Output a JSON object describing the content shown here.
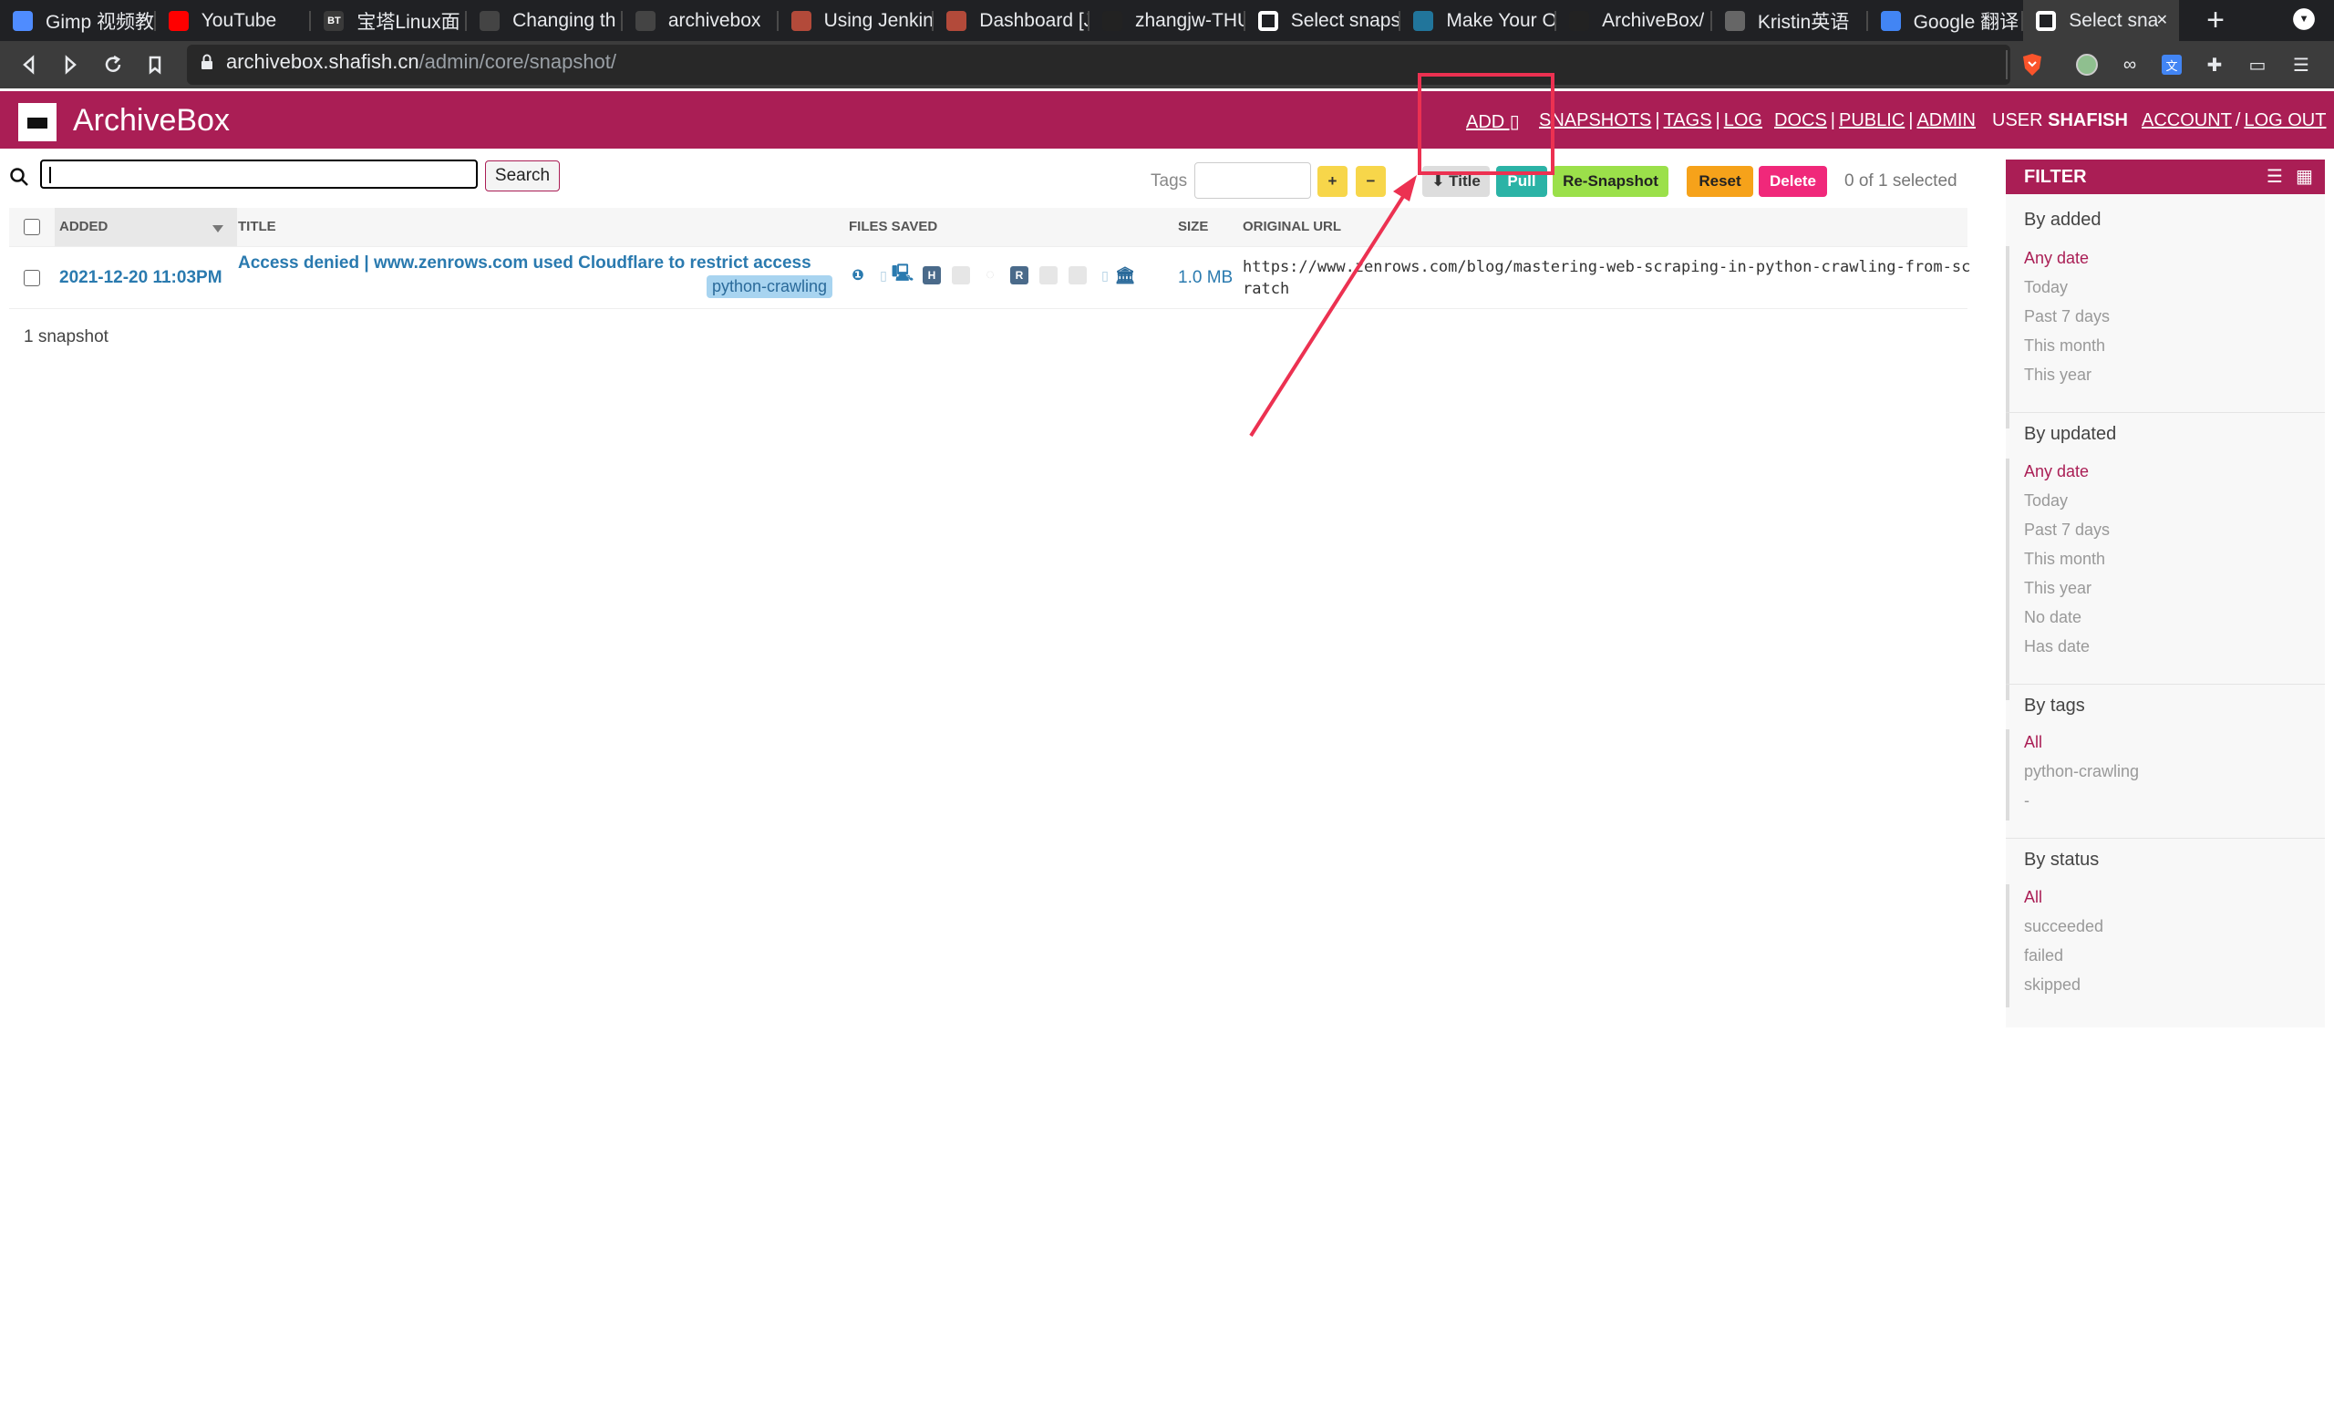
{
  "browser": {
    "tabs": [
      {
        "label": "Gimp 视频教",
        "icon": "calendar-icon",
        "color": "#4f8cff"
      },
      {
        "label": "YouTube",
        "icon": "youtube-icon",
        "color": "#ff0000"
      },
      {
        "label": "宝塔Linux面",
        "icon": "bt-icon",
        "color": "#3a3a3a",
        "glyph": "BT"
      },
      {
        "label": "Changing th",
        "icon": "owl-icon",
        "color": "#444444"
      },
      {
        "label": "archivebox",
        "icon": "bird-icon",
        "color": "#444444"
      },
      {
        "label": "Using Jenkins",
        "icon": "jenkins-icon",
        "color": "#b34a3a"
      },
      {
        "label": "Dashboard [J",
        "icon": "jenkins-icon",
        "color": "#b34a3a"
      },
      {
        "label": "zhangjw-THU",
        "icon": "github-icon",
        "color": "#222222"
      },
      {
        "label": "Select snaps",
        "icon": "archivebox-icon",
        "color": "#ffffff"
      },
      {
        "label": "Make Your O",
        "icon": "wordpress-icon",
        "color": "#21759b"
      },
      {
        "label": "ArchiveBox/",
        "icon": "github-icon",
        "color": "#222222"
      },
      {
        "label": "Kristin英语",
        "icon": "globe-icon",
        "color": "#666666"
      },
      {
        "label": "Google 翻译",
        "icon": "google-translate-icon",
        "color": "#4285f4"
      },
      {
        "label": "Select sna",
        "icon": "archivebox-icon",
        "color": "#ffffff",
        "active": true
      }
    ],
    "url_host": "archivebox.shafish.cn",
    "url_path": "/admin/core/snapshot/"
  },
  "header": {
    "brand": "ArchiveBox",
    "add": "ADD ▯",
    "snapshots": "SNAPSHOTS",
    "tags": "TAGS",
    "log": "LOG",
    "docs": "DOCS",
    "public": "PUBLIC",
    "admin": "ADMIN",
    "user_prefix": "USER",
    "username": "SHAFISH",
    "account": "ACCOUNT",
    "logout": "LOG OUT",
    "pipe": "|",
    "slash": "/"
  },
  "toolbar": {
    "search_button": "Search",
    "tags_label": "Tags",
    "add_tag": "+",
    "remove_tag": "−",
    "title_button": "⬇ Title",
    "pull_button": "Pull",
    "resnapshot_button": "Re-Snapshot",
    "reset_button": "Reset",
    "delete_button": "Delete",
    "selected_count": "0 of 1 selected",
    "colors": {
      "yellow": "#f7d64a",
      "gray": "#dddddd",
      "teal": "#2bb3a6",
      "green": "#9be04a",
      "orange": "#f6a21a",
      "pink": "#f0287a"
    }
  },
  "table": {
    "columns": {
      "added": "ADDED",
      "title": "TITLE",
      "files_saved": "FILES SAVED",
      "size": "SIZE",
      "original_url": "ORIGINAL URL"
    },
    "rows": [
      {
        "added": "2021-12-20 11:03PM",
        "title": "Access denied | www.zenrows.com used Cloudflare to restrict access",
        "tag": "python-crawling",
        "size": "1.0 MB",
        "url": "https://www.zenrows.com/blog/mastering-web-scraping-in-python-crawling-from-scratch"
      }
    ],
    "count": "1 snapshot"
  },
  "filter": {
    "title": "FILTER",
    "by_added": {
      "heading": "By added",
      "options": [
        "Any date",
        "Today",
        "Past 7 days",
        "This month",
        "This year"
      ]
    },
    "by_updated": {
      "heading": "By updated",
      "options": [
        "Any date",
        "Today",
        "Past 7 days",
        "This month",
        "This year",
        "No date",
        "Has date"
      ]
    },
    "by_tags": {
      "heading": "By tags",
      "options": [
        "All",
        "python-crawling",
        "-"
      ]
    },
    "by_status": {
      "heading": "By status",
      "options": [
        "All",
        "succeeded",
        "failed",
        "skipped"
      ]
    }
  }
}
